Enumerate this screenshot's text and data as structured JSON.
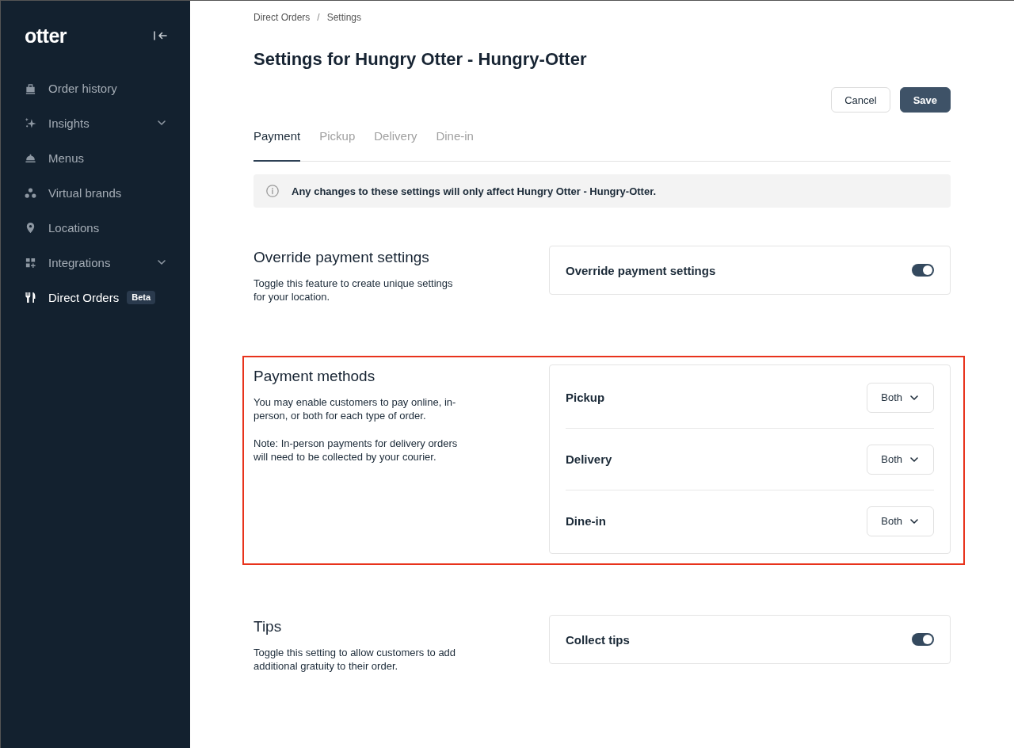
{
  "sidebar": {
    "logo": "otter",
    "items": [
      {
        "label": "Order history",
        "expandable": false,
        "selected": false
      },
      {
        "label": "Insights",
        "expandable": true,
        "selected": false
      },
      {
        "label": "Menus",
        "expandable": false,
        "selected": false
      },
      {
        "label": "Virtual brands",
        "expandable": false,
        "selected": false
      },
      {
        "label": "Locations",
        "expandable": false,
        "selected": false
      },
      {
        "label": "Integrations",
        "expandable": true,
        "selected": false
      },
      {
        "label": "Direct Orders",
        "badge": "Beta",
        "expandable": false,
        "selected": true
      }
    ]
  },
  "breadcrumb": {
    "items": [
      "Direct Orders",
      "Settings"
    ],
    "separator": "/"
  },
  "title": "Settings for Hungry Otter - Hungry-Otter",
  "actions": [
    {
      "label": "Cancel",
      "kind": "secondary"
    },
    {
      "label": "Save",
      "kind": "primary"
    }
  ],
  "tabs": [
    {
      "label": "Payment",
      "selected": true
    },
    {
      "label": "Pickup",
      "selected": false
    },
    {
      "label": "Delivery",
      "selected": false
    },
    {
      "label": "Dine-in",
      "selected": false
    }
  ],
  "notice": "Any changes to these settings will only affect Hungry Otter - Hungry-Otter.",
  "sections": [
    {
      "title": "Override payment settings",
      "description": [
        "Toggle this feature to create unique settings for your location."
      ],
      "highlighted": false,
      "rows": [
        {
          "kind": "toggle",
          "label": "Override payment settings",
          "on": true
        }
      ]
    },
    {
      "title": "Payment methods",
      "description": [
        "You may enable customers to pay online, in-person, or both for each type of order.",
        "Note: In-person payments for delivery orders will need to be collected by your courier."
      ],
      "highlighted": true,
      "rows": [
        {
          "kind": "select",
          "label": "Pickup",
          "value": "Both"
        },
        {
          "kind": "select",
          "label": "Delivery",
          "value": "Both"
        },
        {
          "kind": "select",
          "label": "Dine-in",
          "value": "Both"
        }
      ]
    },
    {
      "title": "Tips",
      "description": [
        "Toggle this setting to allow customers to add additional gratuity to their order."
      ],
      "highlighted": false,
      "rows": [
        {
          "kind": "toggle",
          "label": "Collect tips",
          "on": true
        }
      ]
    }
  ]
}
